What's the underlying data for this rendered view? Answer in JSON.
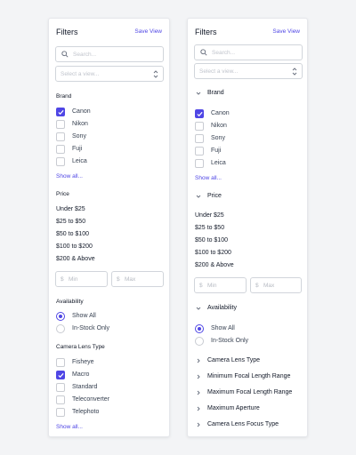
{
  "left": {
    "title": "Filters",
    "save_view": "Save View",
    "search_placeholder": "Search...",
    "select_placeholder": "Select a view...",
    "brand": {
      "title": "Brand",
      "options": [
        {
          "label": "Canon",
          "checked": true
        },
        {
          "label": "Nikon",
          "checked": false
        },
        {
          "label": "Sony",
          "checked": false
        },
        {
          "label": "Fuji",
          "checked": false
        },
        {
          "label": "Leica",
          "checked": false
        }
      ],
      "show_all": "Show all..."
    },
    "price": {
      "title": "Price",
      "options": [
        "Under $25",
        "$25 to $50",
        "$50 to $100",
        "$100 to $200",
        "$200 & Above"
      ],
      "currency": "$",
      "min_placeholder": "Min",
      "max_placeholder": "Max"
    },
    "availability": {
      "title": "Availability",
      "options": [
        {
          "label": "Show All",
          "selected": true
        },
        {
          "label": "In-Stock Only",
          "selected": false
        }
      ]
    },
    "lens_type": {
      "title": "Camera Lens Type",
      "options": [
        {
          "label": "Fisheye",
          "checked": false
        },
        {
          "label": "Macro",
          "checked": true
        },
        {
          "label": "Standard",
          "checked": false
        },
        {
          "label": "Teleconverter",
          "checked": false
        },
        {
          "label": "Telephoto",
          "checked": false
        }
      ],
      "show_all": "Show all..."
    }
  },
  "right": {
    "title": "Filters",
    "save_view": "Save View",
    "search_placeholder": "Search...",
    "select_placeholder": "Select a view...",
    "brand": {
      "title": "Brand",
      "options": [
        {
          "label": "Canon",
          "checked": true
        },
        {
          "label": "Nikon",
          "checked": false
        },
        {
          "label": "Sony",
          "checked": false
        },
        {
          "label": "Fuji",
          "checked": false
        },
        {
          "label": "Leica",
          "checked": false
        }
      ],
      "show_all": "Show all..."
    },
    "price": {
      "title": "Price",
      "options": [
        "Under $25",
        "$25 to $50",
        "$50 to $100",
        "$100 to $200",
        "$200 & Above"
      ],
      "currency": "$",
      "min_placeholder": "Min",
      "max_placeholder": "Max"
    },
    "availability": {
      "title": "Availability",
      "options": [
        {
          "label": "Show All",
          "selected": true
        },
        {
          "label": "In-Stock Only",
          "selected": false
        }
      ]
    },
    "collapsed_sections": [
      "Camera Lens Type",
      "Minimum Focal Length Range",
      "Maximum Focal Length Range",
      "Maximum Aperture",
      "Camera Lens Focus Type"
    ]
  },
  "colors": {
    "accent": "#4f46e5",
    "background": "#f3f4f6",
    "panel": "#ffffff",
    "border": "#e5e7eb"
  },
  "icons": {
    "search": "search-icon",
    "select": "chevron-up-down-icon",
    "expanded": "chevron-down-icon",
    "collapsed": "chevron-right-icon",
    "check": "check-icon"
  }
}
